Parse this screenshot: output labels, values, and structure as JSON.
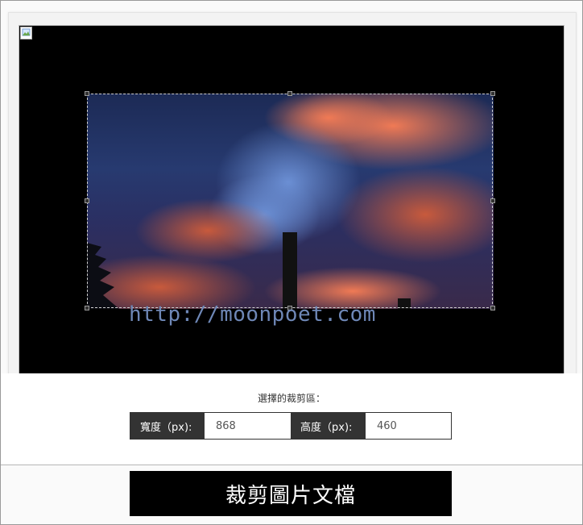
{
  "editor": {
    "watermark": "http://moonpoet.com"
  },
  "selection": {
    "label": "選擇的裁剪區：",
    "width_label": "寬度（px):",
    "width_value": "868",
    "height_label": "高度（px):",
    "height_value": "460"
  },
  "actions": {
    "crop_label": "裁剪圖片文檔"
  },
  "colors": {
    "button_bg": "#000000",
    "label_bg": "#333333",
    "watermark": "#6e87b6"
  }
}
